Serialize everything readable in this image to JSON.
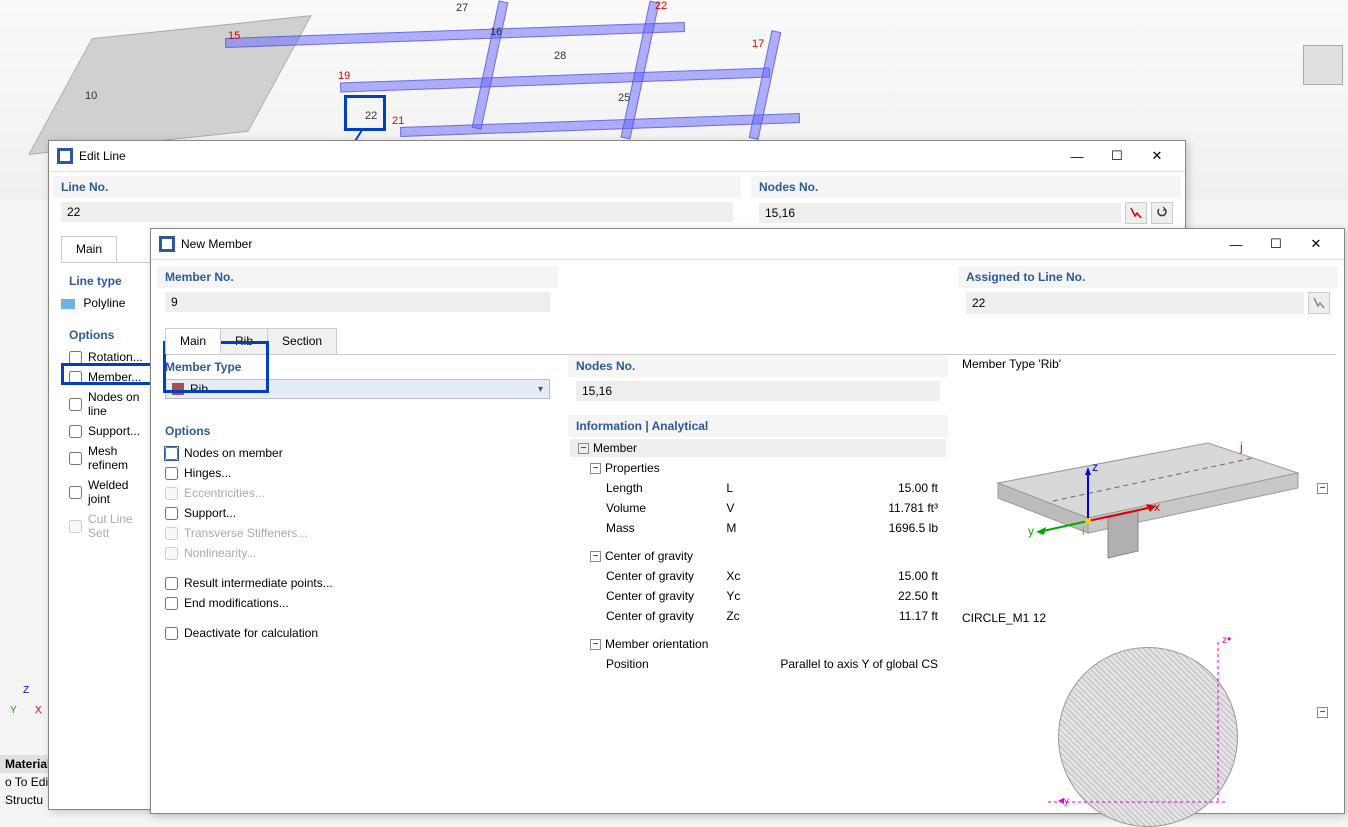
{
  "model": {
    "labels": {
      "n10": "10",
      "n15": "15",
      "n16": "16",
      "n17": "17",
      "n19": "19",
      "n21": "21",
      "n22": "22",
      "n22b": "22",
      "n25": "25",
      "n27": "27",
      "n28": "28"
    }
  },
  "axes": {
    "z": "Z",
    "y": "Y",
    "x": "X"
  },
  "sidePanel": {
    "materials": "Materials",
    "goto": "o To  Edit",
    "structu": "Structu"
  },
  "editLine": {
    "title": "Edit Line",
    "lineNoLabel": "Line No.",
    "lineNoValue": "22",
    "nodesNoLabel": "Nodes No.",
    "nodesNoValue": "15,16",
    "tabMain": "Main",
    "lineTypeLabel": "Line type",
    "lineTypeValue": "Polyline",
    "optionsLabel": "Options",
    "options": {
      "rotation": "Rotation...",
      "member": "Member...",
      "nodesOnLine": "Nodes on line",
      "support": "Support...",
      "meshRefine": "Mesh refinem",
      "weldedJoint": "Welded joint",
      "cutLine": "Cut Line Sett"
    }
  },
  "newMember": {
    "title": "New Member",
    "memberNoLabel": "Member No.",
    "memberNoValue": "9",
    "assignedLabel": "Assigned to Line No.",
    "assignedValue": "22",
    "tabs": {
      "main": "Main",
      "rib": "Rib",
      "section": "Section"
    },
    "memberTypeLabel": "Member Type",
    "memberTypeValue": "Rib",
    "optionsLabel": "Options",
    "options": {
      "nodesOnMember": "Nodes on member",
      "hinges": "Hinges...",
      "eccentricities": "Eccentricities...",
      "support": "Support...",
      "transverse": "Transverse Stiffeners...",
      "nonlinearity": "Nonlinearity...",
      "resultIntermediate": "Result intermediate points...",
      "endModifications": "End modifications...",
      "deactivate": "Deactivate for calculation"
    },
    "nodesNoLabel": "Nodes No.",
    "nodesNoValue": "15,16",
    "infoLabel": "Information | Analytical",
    "info": {
      "member": "Member",
      "properties": "Properties",
      "length": "Length",
      "lengthSym": "L",
      "lengthVal": "15.00 ft",
      "volume": "Volume",
      "volumeSym": "V",
      "volumeVal": "11.781 ft³",
      "mass": "Mass",
      "massSym": "M",
      "massVal": "1696.5 lb",
      "cog": "Center of gravity",
      "cogX": "Center of gravity",
      "cogXSym": "Xc",
      "cogXVal": "15.00 ft",
      "cogY": "Center of gravity",
      "cogYSym": "Yc",
      "cogYVal": "22.50 ft",
      "cogZ": "Center of gravity",
      "cogZSym": "Zc",
      "cogZVal": "11.17 ft",
      "orientation": "Member orientation",
      "position": "Position",
      "positionVal": "Parallel to axis Y of global CS"
    },
    "previewTop": "Member Type 'Rib'",
    "previewBottom": "CIRCLE_M1 12",
    "previewAxes": {
      "z": "z",
      "y": "y",
      "x": "x",
      "i": "i",
      "j": "j"
    }
  }
}
